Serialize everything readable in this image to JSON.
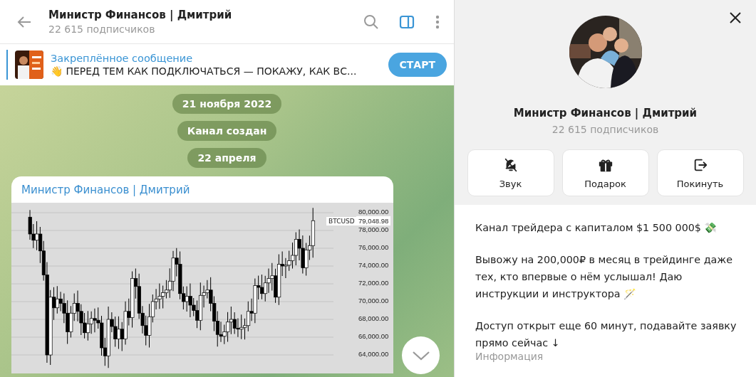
{
  "header": {
    "title": "Министр Финансов | Дмитрий",
    "subtitle": "22 615 подписчиков"
  },
  "pinned": {
    "label": "Закреплённое сообщение",
    "text": "👋 ПЕРЕД ТЕМ КАК ПОДКЛЮЧАТЬСЯ — ПОКАЖУ, КАК ВС...",
    "button": "СТАРТ"
  },
  "service_messages": [
    "21 ноября 2022",
    "Канал создан",
    "22 апреля"
  ],
  "message": {
    "author": "Министр Финансов | Дмитрий",
    "chart_image": {
      "ticker": "BTCUSD",
      "price": "79,048.98",
      "y_axis_labels": [
        "80,000.00",
        "78,000.00",
        "76,000.00",
        "74,000.00",
        "72,000.00",
        "70,000.00",
        "68,000.00",
        "66,000.00",
        "64,000.00"
      ]
    }
  },
  "profile": {
    "name": "Министр Финансов | Дмитрий",
    "subtitle": "22 615 подписчиков",
    "actions": [
      {
        "kind": "mute",
        "label": "Звук"
      },
      {
        "kind": "gift",
        "label": "Подарок"
      },
      {
        "kind": "leave",
        "label": "Покинуть"
      }
    ],
    "description": [
      "Канал трейдера с капиталом $1 500 000$ 💸",
      "Вывожу на 200,000₽ в месяц в трейдинге даже тех, кто впервые о нём услышал! Даю инструкции и инструктора 🪄",
      "Доступ открыт еще 60 минут, подавайте заявку прямо сейчас ↓"
    ],
    "description_caption": "Информация"
  }
}
